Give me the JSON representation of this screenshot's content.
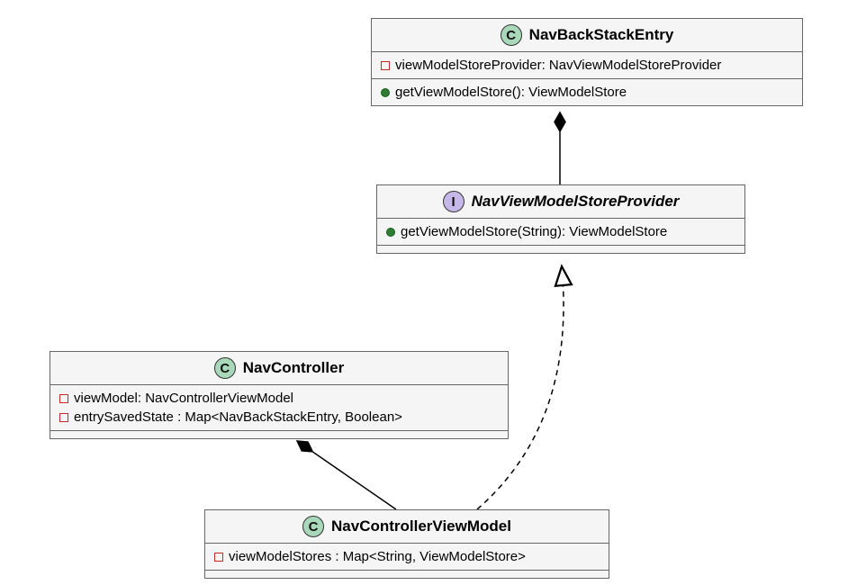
{
  "classes": {
    "navBackStackEntry": {
      "stereotype": "C",
      "name": "NavBackStackEntry",
      "abstract": false,
      "attributes": [
        {
          "visibility": "private",
          "text": "viewModelStoreProvider: NavViewModelStoreProvider"
        }
      ],
      "operations": [
        {
          "visibility": "public",
          "text": "getViewModelStore(): ViewModelStore"
        }
      ]
    },
    "navViewModelStoreProvider": {
      "stereotype": "I",
      "name": "NavViewModelStoreProvider",
      "abstract": true,
      "attributes": [],
      "operations": [
        {
          "visibility": "public",
          "text": "getViewModelStore(String): ViewModelStore"
        }
      ]
    },
    "navController": {
      "stereotype": "C",
      "name": "NavController",
      "abstract": false,
      "attributes": [
        {
          "visibility": "private",
          "text": "viewModel: NavControllerViewModel"
        },
        {
          "visibility": "private",
          "text": "entrySavedState : Map<NavBackStackEntry, Boolean>"
        }
      ],
      "operations": []
    },
    "navControllerViewModel": {
      "stereotype": "C",
      "name": "NavControllerViewModel",
      "abstract": false,
      "attributes": [
        {
          "visibility": "private",
          "text": "viewModelStores : Map<String, ViewModelStore>"
        }
      ],
      "operations": []
    }
  },
  "relationships": [
    {
      "from": "NavViewModelStoreProvider",
      "to": "NavBackStackEntry",
      "type": "composition"
    },
    {
      "from": "NavControllerViewModel",
      "to": "NavViewModelStoreProvider",
      "type": "realization"
    },
    {
      "from": "NavControllerViewModel",
      "to": "NavController",
      "type": "composition"
    }
  ]
}
